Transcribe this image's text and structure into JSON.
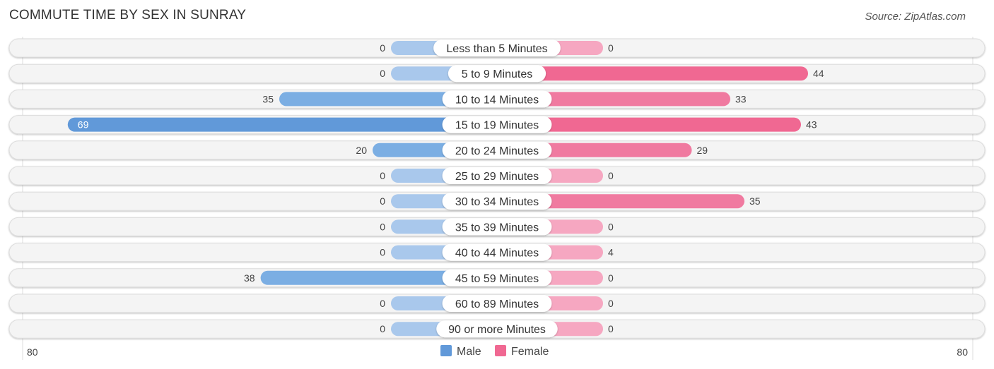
{
  "title": "COMMUTE TIME BY SEX IN SUNRAY",
  "source": "Source: ZipAtlas.com",
  "chart_data": {
    "type": "bar",
    "orientation": "horizontal-diverging",
    "title": "COMMUTE TIME BY SEX IN SUNRAY",
    "categories": [
      "Less than 5 Minutes",
      "5 to 9 Minutes",
      "10 to 14 Minutes",
      "15 to 19 Minutes",
      "20 to 24 Minutes",
      "25 to 29 Minutes",
      "30 to 34 Minutes",
      "35 to 39 Minutes",
      "40 to 44 Minutes",
      "45 to 59 Minutes",
      "60 to 89 Minutes",
      "90 or more Minutes"
    ],
    "series": [
      {
        "name": "Male",
        "color": "#6199d9",
        "light_color": "#a9c8ec",
        "values": [
          0,
          0,
          35,
          69,
          20,
          0,
          0,
          0,
          0,
          38,
          0,
          0
        ]
      },
      {
        "name": "Female",
        "color": "#f06892",
        "light_color": "#f6a7c1",
        "values": [
          0,
          44,
          33,
          43,
          29,
          0,
          35,
          0,
          4,
          0,
          0,
          0
        ]
      }
    ],
    "axis_min_label": "80",
    "axis_max_label": "80",
    "xlim": [
      -80,
      80
    ],
    "legend": {
      "position": "bottom-center",
      "items": [
        "Male",
        "Female"
      ]
    }
  }
}
